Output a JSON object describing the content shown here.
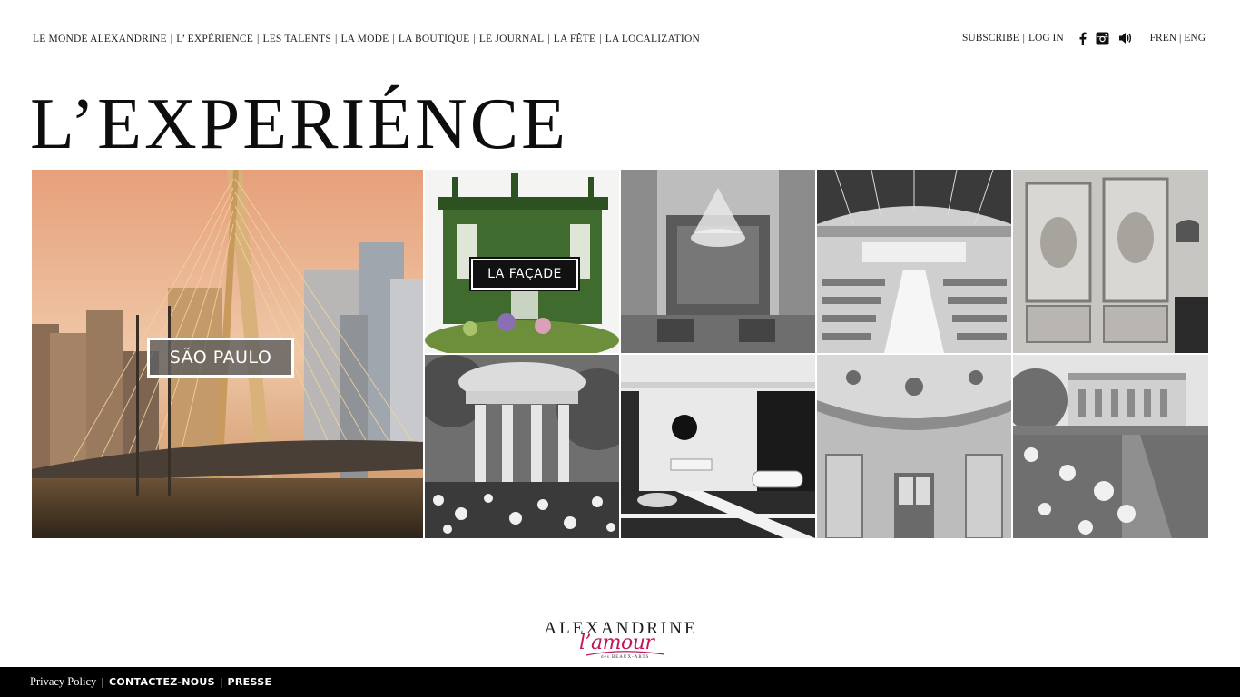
{
  "nav": {
    "items": [
      {
        "label": "LE MONDE ALEXANDRINE"
      },
      {
        "label": "L’ EXPÉRIENCE"
      },
      {
        "label": "LES TALENTS"
      },
      {
        "label": "LA MODE"
      },
      {
        "label": "LA BOUTIQUE"
      },
      {
        "label": "LE JOURNAL"
      },
      {
        "label": "LA FÊTE"
      },
      {
        "label": "LA LOCALIZATION"
      }
    ],
    "separator": "|"
  },
  "account": {
    "subscribe": "SUBSCRIBE",
    "login": "LOG IN",
    "separator": "|"
  },
  "social": {
    "icons": [
      "facebook-icon",
      "instagram-icon",
      "sound-icon"
    ]
  },
  "language": {
    "fr": "FREN",
    "en": "ENG",
    "separator": "|"
  },
  "page": {
    "title": "L’EXPERIÉNCE"
  },
  "gallery": {
    "featured_label": "SÃO PAULO",
    "facade_label": "LA FAÇADE"
  },
  "logo": {
    "wordmark": "ALEXANDRINE",
    "script": "l’amour",
    "sub1": "des",
    "sub2": "BEAUX-ARTS"
  },
  "footer": {
    "privacy": "Privacy Policy",
    "contact": "CONTACTEZ-NOUS",
    "press": "PRESSE",
    "separator": "|"
  },
  "colors": {
    "footer_bg": "#000000",
    "logo_script": "#c2185b",
    "text": "#111111"
  }
}
